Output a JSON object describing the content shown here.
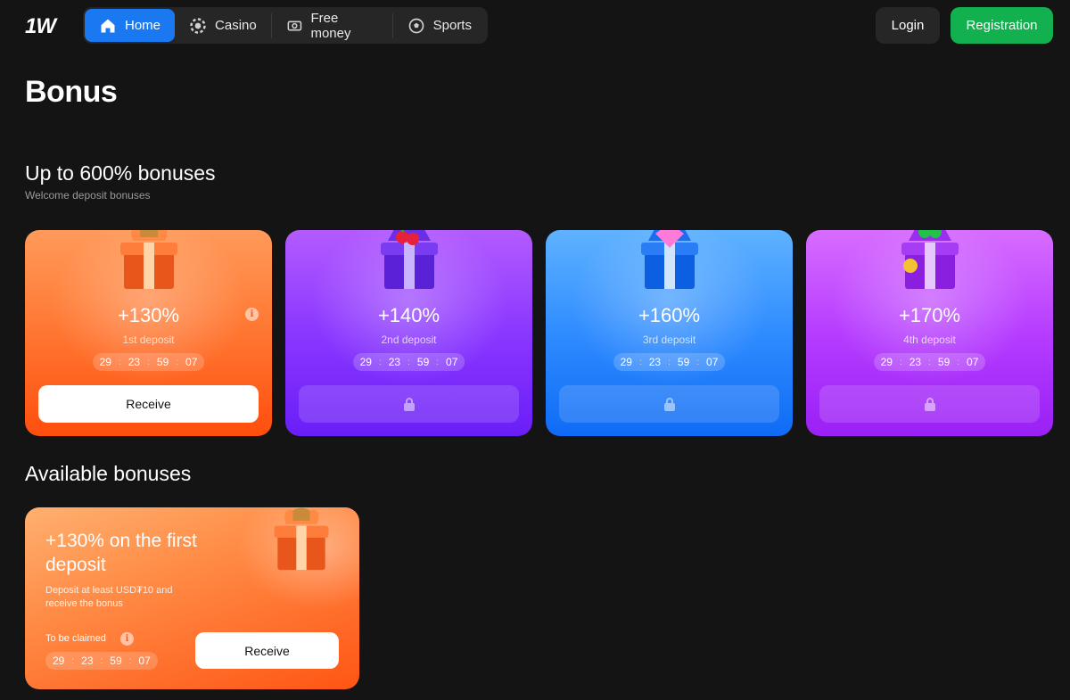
{
  "header": {
    "logo": "1W",
    "nav": [
      {
        "label": "Home",
        "icon": "home-icon",
        "active": true
      },
      {
        "label": "Casino",
        "icon": "casino-chip-icon",
        "active": false
      },
      {
        "label": "Free money",
        "icon": "money-icon",
        "active": false
      },
      {
        "label": "Sports",
        "icon": "soccer-ball-icon",
        "active": false
      }
    ],
    "login_label": "Login",
    "registration_label": "Registration"
  },
  "page": {
    "title": "Bonus"
  },
  "deposit_section": {
    "title": "Up to 600% bonuses",
    "subtitle": "Welcome deposit bonuses",
    "cards": [
      {
        "percent": "+130%",
        "deposit": "1st deposit",
        "timer": [
          "29",
          "23",
          "59",
          "07"
        ],
        "button": "Receive",
        "locked": false,
        "color": "#ff6a22"
      },
      {
        "percent": "+140%",
        "deposit": "2nd deposit",
        "timer": [
          "29",
          "23",
          "59",
          "07"
        ],
        "button": "",
        "locked": true,
        "color": "#8a37ff"
      },
      {
        "percent": "+160%",
        "deposit": "3rd deposit",
        "timer": [
          "29",
          "23",
          "59",
          "07"
        ],
        "button": "",
        "locked": true,
        "color": "#2f8cff"
      },
      {
        "percent": "+170%",
        "deposit": "4th deposit",
        "timer": [
          "29",
          "23",
          "59",
          "07"
        ],
        "button": "",
        "locked": true,
        "color": "#b63dff"
      }
    ]
  },
  "available_section": {
    "title": "Available bonuses",
    "card": {
      "title": "+130% on the first deposit",
      "description": "Deposit at least USD₮10 and receive the bonus",
      "claim_label": "To be claimed",
      "timer": [
        "29",
        "23",
        "59",
        "07"
      ],
      "button": "Receive"
    }
  },
  "colors": {
    "background": "#141414",
    "accent_blue": "#1a78f0",
    "registration_green": "#12b04e"
  }
}
